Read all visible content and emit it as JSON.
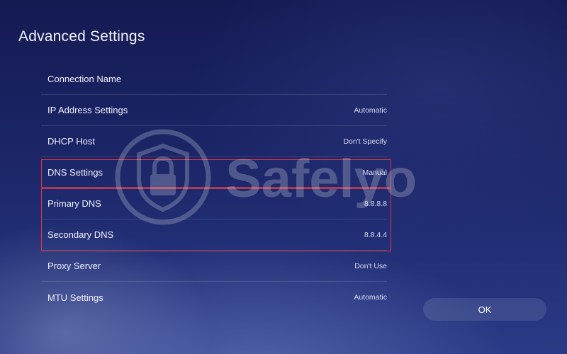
{
  "page": {
    "title": "Advanced Settings"
  },
  "settings": {
    "rows": [
      {
        "label": "Connection Name",
        "value": ""
      },
      {
        "label": "IP Address Settings",
        "value": "Automatic"
      },
      {
        "label": "DHCP Host",
        "value": "Don't Specify"
      },
      {
        "label": "DNS Settings",
        "value": "Manual"
      },
      {
        "label": "Primary DNS",
        "value": "8.8.8.8"
      },
      {
        "label": "Secondary DNS",
        "value": "8.8.4.4"
      },
      {
        "label": "Proxy Server",
        "value": "Don't Use"
      },
      {
        "label": "MTU Settings",
        "value": "Automatic"
      }
    ]
  },
  "actions": {
    "ok_label": "OK"
  },
  "watermark": {
    "text": "Safelyo",
    "icon": "padlock-shield-icon"
  },
  "colors": {
    "highlight": "#e0353f",
    "background_top": "#141a52",
    "background_bottom": "#2a3a86"
  }
}
